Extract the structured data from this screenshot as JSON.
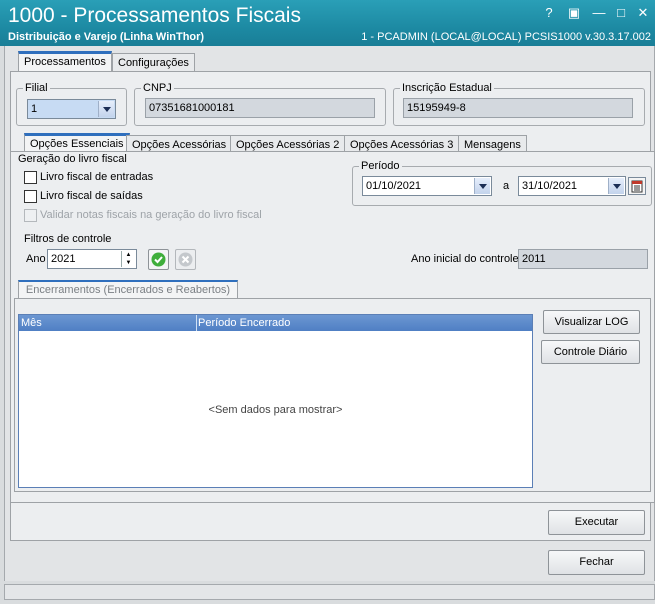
{
  "window": {
    "title": "1000 - Processamentos Fiscais",
    "subtitle": "Distribuição e Varejo (Linha WinThor)",
    "status": "1 - PCADMIN (LOCAL@LOCAL)   PCSIS1000  v.30.3.17.002",
    "buttons": {
      "help": "?",
      "restore": "▣",
      "minimize": "—",
      "maximize": "□",
      "close": "✕"
    }
  },
  "main_tabs": [
    "Processamentos",
    "Configurações"
  ],
  "filial": {
    "label": "Filial",
    "value": "1"
  },
  "cnpj": {
    "label": "CNPJ",
    "value": "07351681000181"
  },
  "inscricao": {
    "label": "Inscrição Estadual",
    "value": "15195949-8"
  },
  "sub_tabs": [
    "Opções Essenciais",
    "Opções Acessórias",
    "Opções Acessórias 2",
    "Opções Acessórias 3",
    "Mensagens"
  ],
  "geracao": {
    "title": "Geração do livro fiscal",
    "entradas": "Livro fiscal de entradas",
    "saidas": "Livro fiscal de saídas",
    "validar": "Validar notas fiscais na geração do livro fiscal"
  },
  "periodo": {
    "label": "Período",
    "start": "01/10/2021",
    "sep": "a",
    "end": "31/10/2021"
  },
  "filtros": {
    "title": "Filtros de controle",
    "ano_label": "Ano",
    "ano_value": "2021",
    "ano_inicial_label": "Ano inicial do controle",
    "ano_inicial_value": "2011"
  },
  "encerramentos": {
    "tab": "Encerramentos (Encerrados e Reabertos)",
    "columns": [
      "Mês",
      "Período Encerrado"
    ],
    "empty": "<Sem dados para mostrar>"
  },
  "actions": {
    "log": "Visualizar LOG",
    "controle": "Controle Diário",
    "executar": "Executar",
    "fechar": "Fechar"
  },
  "colors": {
    "title_bar": "#1d8aa3",
    "grid_header": "#5a88c9",
    "tab_accent": "#2f6fbd"
  }
}
